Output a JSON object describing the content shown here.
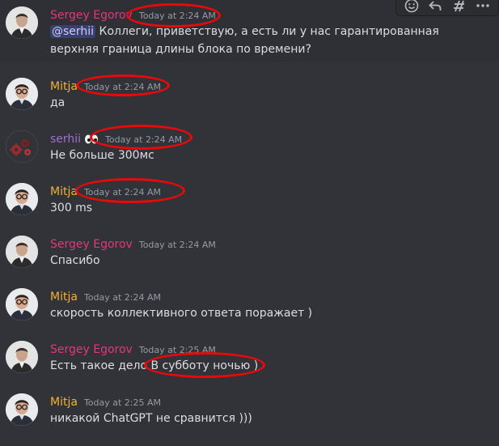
{
  "colors": {
    "background": "#313338",
    "sergey": "#e3367c",
    "mitja": "#f0b232",
    "serhii": "#a46ccf",
    "text": "#dbdee1",
    "timestamp": "#949ba4",
    "highlight_circle": "#e8090b"
  },
  "messages": [
    {
      "author": "Sergey Egorov",
      "timestamp": "Today at 2:24 AM",
      "mention": "@serhii",
      "text": " Коллеги, приветствую, а есть ли у нас гарантированная верхняя граница длины блока по времени?",
      "avatar_icon": "sergey-avatar-icon"
    },
    {
      "author": "Mitja",
      "timestamp": "Today at 2:24 AM",
      "text": "да",
      "avatar_icon": "mitja-avatar-icon"
    },
    {
      "author": "serhii",
      "timestamp": "Today at 2:24 AM",
      "text": "Не больше 300мс",
      "avatar_icon": "serhii-avatar-icon",
      "badge_icon": "eyes-emoji-icon"
    },
    {
      "author": "Mitja",
      "timestamp": "Today at 2:24 AM",
      "text": "300 ms",
      "avatar_icon": "mitja-avatar-icon"
    },
    {
      "author": "Sergey Egorov",
      "timestamp": "Today at 2:24 AM",
      "text": "Спасибо",
      "avatar_icon": "sergey-avatar-icon"
    },
    {
      "author": "Mitja",
      "timestamp": "Today at 2:24 AM",
      "text": "скорость коллективного ответа поражает )",
      "avatar_icon": "mitja-avatar-icon"
    },
    {
      "author": "Sergey Egorov",
      "timestamp": "Today at 2:25 AM",
      "text_before": "Есть такое дело ",
      "text_circled": "В субботу ночью )",
      "avatar_icon": "sergey-avatar-icon"
    },
    {
      "author": "Mitja",
      "timestamp": "Today at 2:25 AM",
      "text": "никакой ChatGPT не сравнится )))",
      "avatar_icon": "mitja-avatar-icon"
    }
  ],
  "toolbar": {
    "icons": [
      "add-reaction-icon",
      "reply-icon",
      "create-thread-icon",
      "more-options-icon"
    ]
  }
}
